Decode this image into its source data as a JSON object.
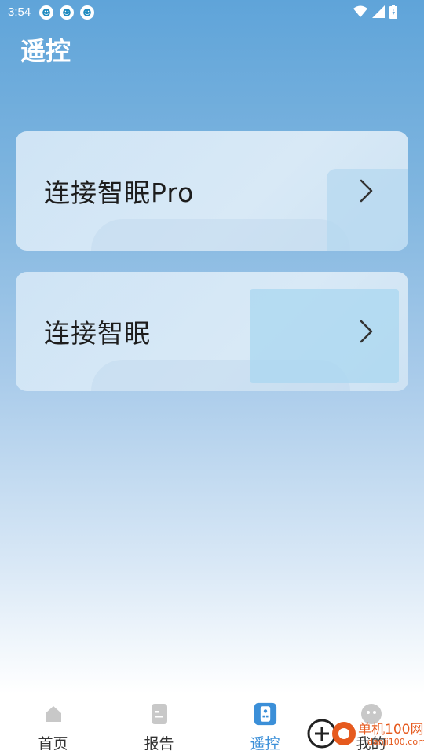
{
  "status_bar": {
    "time": "3:54"
  },
  "header": {
    "title": "遥控"
  },
  "cards": [
    {
      "label": "连接智眠Pro"
    },
    {
      "label": "连接智眠"
    }
  ],
  "tabbar": {
    "tabs": [
      {
        "label": "首页",
        "icon": "home-icon",
        "active": false
      },
      {
        "label": "报告",
        "icon": "report-icon",
        "active": false
      },
      {
        "label": "遥控",
        "icon": "remote-icon",
        "active": true
      },
      {
        "label": "我的",
        "icon": "profile-icon",
        "active": false
      }
    ]
  },
  "watermark": {
    "line1": "单机100网",
    "line2": "danji100.com"
  },
  "colors": {
    "accent": "#3b8fd8",
    "inactive_icon": "#c8c8c8"
  }
}
